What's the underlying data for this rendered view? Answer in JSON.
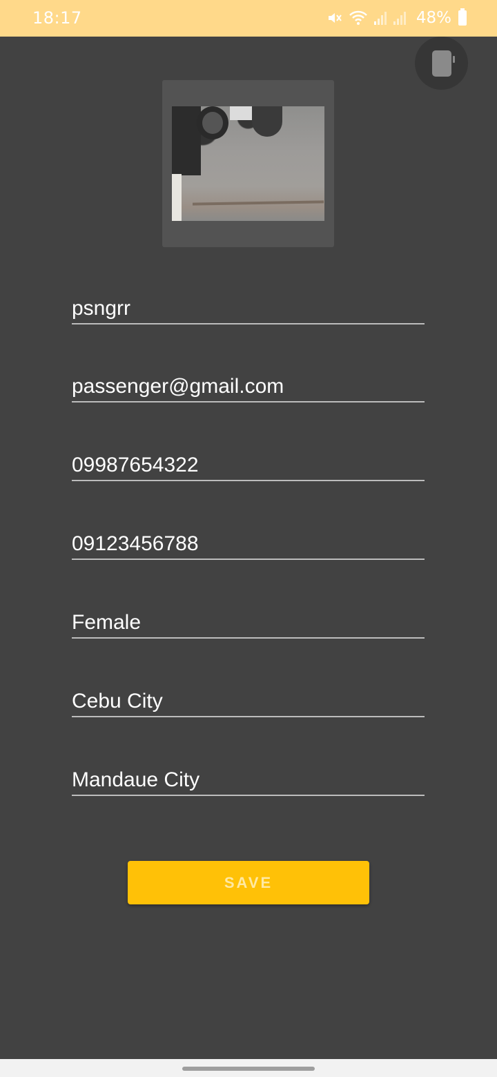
{
  "status_bar": {
    "time": "18:17",
    "battery_percent": "48%",
    "battery_level": 0.48,
    "icons": [
      "mute-icon",
      "wifi-icon",
      "signal-icon",
      "signal-icon-2",
      "battery-icon"
    ],
    "background": "#ffd98a"
  },
  "profile": {
    "username": "psngrr",
    "email": "passenger@gmail.com",
    "phone": "09987654322",
    "emergency_phone": "09123456788",
    "gender": "Female",
    "city": "Cebu City",
    "address": "Mandaue City"
  },
  "actions": {
    "save_label": "SAVE",
    "accent": "#ffc107",
    "rotate_icon": "screen-rotate-icon"
  },
  "theme": {
    "background": "#424242"
  }
}
